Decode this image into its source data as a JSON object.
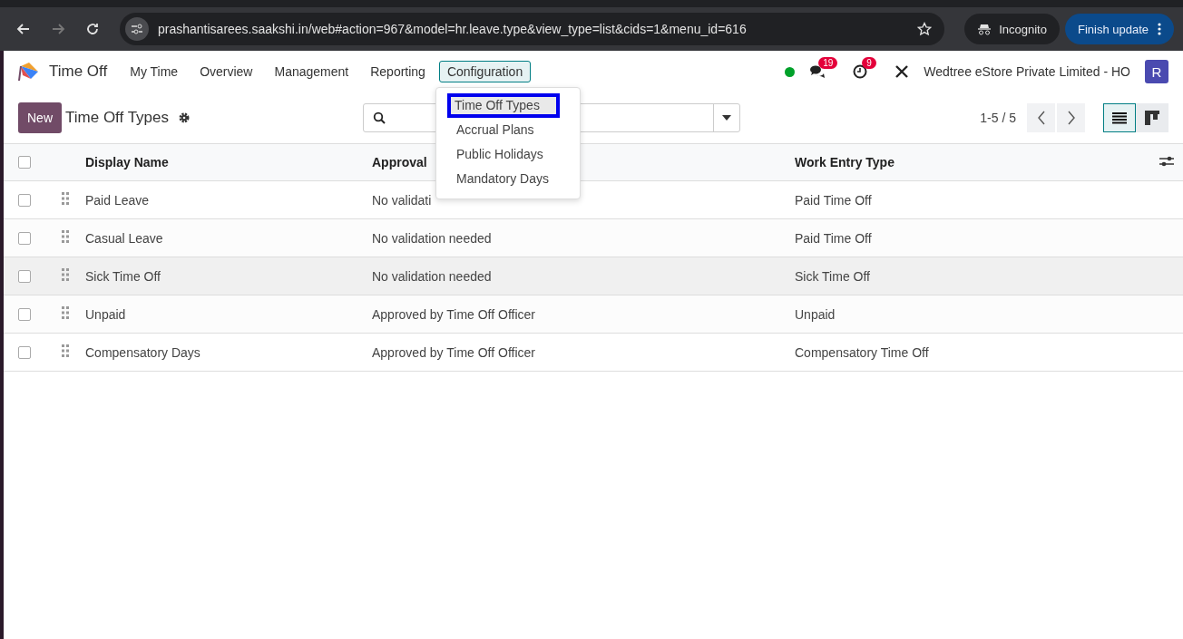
{
  "browser": {
    "url": "prashantisarees.saakshi.in/web#action=967&model=hr.leave.type&view_type=list&cids=1&menu_id=616",
    "incognito": "Incognito",
    "update_button": "Finish update"
  },
  "app": {
    "name": "Time Off",
    "menu": [
      {
        "label": "My Time",
        "selected": false
      },
      {
        "label": "Overview",
        "selected": false
      },
      {
        "label": "Management",
        "selected": false
      },
      {
        "label": "Reporting",
        "selected": false
      },
      {
        "label": "Configuration",
        "selected": true
      }
    ],
    "messages_badge": "19",
    "activities_badge": "9",
    "company": "Wedtree eStore Private Limited - HO",
    "avatar": "R"
  },
  "dropdown": [
    {
      "label": "Time Off Types",
      "selected": true
    },
    {
      "label": "Accrual Plans",
      "selected": false
    },
    {
      "label": "Public Holidays",
      "selected": false
    },
    {
      "label": "Mandatory Days",
      "selected": false
    }
  ],
  "control_panel": {
    "new_button": "New",
    "title": "Time Off Types",
    "pager": "1-5 / 5",
    "views": [
      {
        "kind": "list",
        "selected": true
      },
      {
        "kind": "kanban",
        "selected": false
      }
    ]
  },
  "table": {
    "all_checked": false,
    "columns": [
      "Display Name",
      "Approval",
      "Work Entry Type"
    ],
    "rows": [
      {
        "checked": false,
        "highlighted": false,
        "cells": [
          "Paid Leave",
          "No validati",
          "Paid Time Off"
        ]
      },
      {
        "checked": false,
        "highlighted": false,
        "cells": [
          "Casual Leave",
          "No validation needed",
          "Paid Time Off"
        ]
      },
      {
        "checked": false,
        "highlighted": true,
        "cells": [
          "Sick Time Off",
          "No validation needed",
          "Sick Time Off"
        ]
      },
      {
        "checked": false,
        "highlighted": false,
        "cells": [
          "Unpaid",
          "Approved by Time Off Officer",
          "Unpaid"
        ]
      },
      {
        "checked": false,
        "highlighted": false,
        "cells": [
          "Compensatory Days",
          "Approved by Time Off Officer",
          "Compensatory Time Off"
        ]
      }
    ]
  }
}
